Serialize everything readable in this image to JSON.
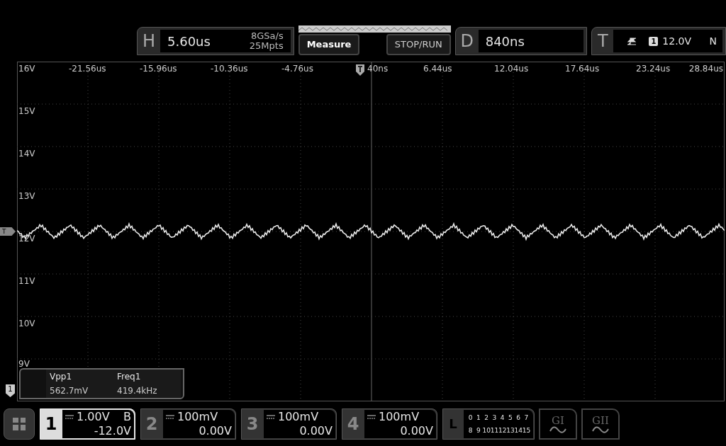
{
  "horizontal": {
    "letter": "H",
    "value": "5.60us",
    "sample_rate": "8GSa/s",
    "memory_depth": "25Mpts"
  },
  "buttons": [
    "Measure",
    "STOP/RUN"
  ],
  "delay": {
    "letter": "D",
    "value": "840ns"
  },
  "trigger": {
    "letter": "T",
    "source": "1",
    "level": "12.0V",
    "mode": "N"
  },
  "time_labels": [
    "-21.56us",
    "-15.96us",
    "-10.36us",
    "-4.76us",
    "40ns",
    "6.44us",
    "12.04us",
    "17.64us",
    "23.24us",
    "28.84us"
  ],
  "volt_labels": [
    "16V",
    "15V",
    "14V",
    "13V",
    "12V",
    "11V",
    "10V",
    "9V"
  ],
  "trigger_marker": "T",
  "channel_marker": "1",
  "measurements": [
    {
      "name": "Vpp1",
      "value": "562.7mV"
    },
    {
      "name": "Freq1",
      "value": "419.4kHz"
    }
  ],
  "channels": [
    {
      "label": "1",
      "scale": "1.00V",
      "offset": "-12.0V",
      "flag": "B",
      "selected": true
    },
    {
      "label": "2",
      "scale": "100mV",
      "offset": "0.00V",
      "selected": false
    },
    {
      "label": "3",
      "scale": "100mV",
      "offset": "0.00V",
      "selected": false
    },
    {
      "label": "4",
      "scale": "100mV",
      "offset": "0.00V",
      "selected": false
    }
  ],
  "logic": {
    "letter": "L",
    "bits": [
      "0",
      "1",
      "2",
      "3",
      "4",
      "5",
      "6",
      "7",
      "8",
      "9",
      "10",
      "11",
      "12",
      "13",
      "14",
      "15"
    ]
  },
  "generators": [
    "GI",
    "GII"
  ]
}
